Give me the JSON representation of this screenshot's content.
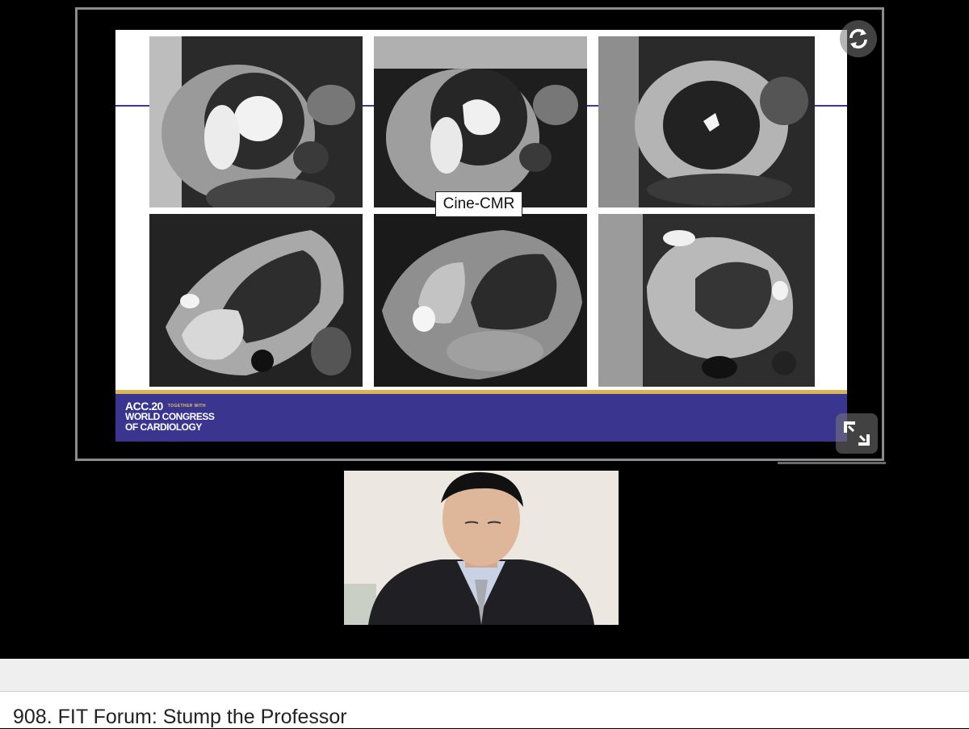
{
  "slide": {
    "caption": "Cine-CMR",
    "footer_logo": {
      "line1": "ACC.20",
      "together": "TOGETHER WITH",
      "line2": "WORLD CONGRESS",
      "line3": "OF CARDIOLOGY"
    },
    "colors": {
      "footer": "#3a358f",
      "footer_accent": "#d9b45a",
      "rule": "#3c3a8e"
    }
  },
  "controls": {
    "sync_icon": "sync-icon",
    "expand_icon": "expand-icon"
  },
  "session": {
    "title": "908. FIT Forum: Stump the Professor"
  }
}
